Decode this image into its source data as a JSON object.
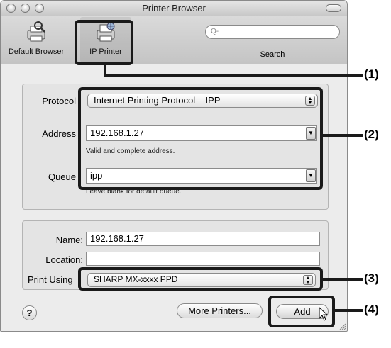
{
  "window": {
    "title": "Printer Browser"
  },
  "toolbar": {
    "default_browser_label": "Default Browser",
    "ip_printer_label": "IP Printer",
    "search_label": "Search",
    "search_placeholder": "Q-"
  },
  "form": {
    "protocol_label": "Protocol",
    "protocol_value": "Internet Printing Protocol – IPP",
    "address_label": "Address",
    "address_value": "192.168.1.27",
    "address_hint": "Valid and complete address.",
    "queue_label": "Queue",
    "queue_value": "ipp",
    "queue_hint": "Leave blank for default queue."
  },
  "details": {
    "name_label": "Name:",
    "name_value": "192.168.1.27",
    "location_label": "Location:",
    "location_value": "",
    "print_using_label": "Print Using",
    "print_using_value": "SHARP MX-xxxx PPD"
  },
  "buttons": {
    "help": "?",
    "more_printers": "More Printers...",
    "add": "Add"
  },
  "callouts": {
    "c1": "(1)",
    "c2": "(2)",
    "c3": "(3)",
    "c4": "(4)"
  }
}
